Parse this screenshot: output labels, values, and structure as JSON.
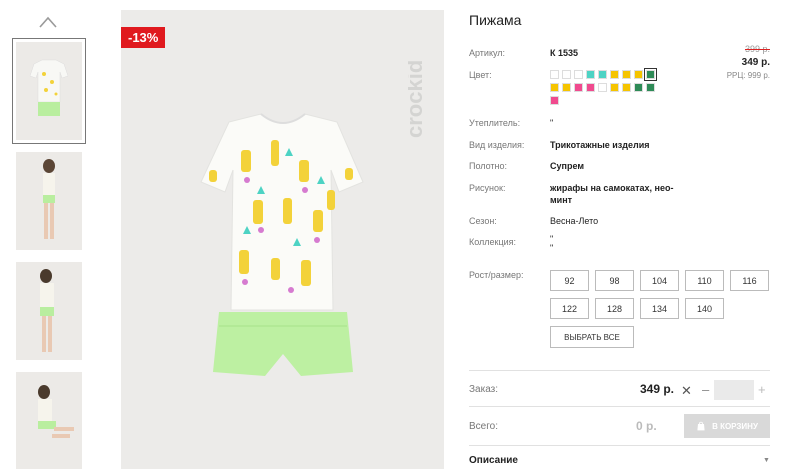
{
  "product": {
    "title": "Пижама",
    "discount_badge": "-13%",
    "brand_logo_text": "crockid",
    "price_old": "399 р.",
    "price_new": "349 р.",
    "rrp": "РРЦ: 999 р."
  },
  "attributes": [
    {
      "label": "Артикул:",
      "value": "К 1535",
      "bold": true
    },
    {
      "label": "Цвет:",
      "value": ""
    },
    {
      "label": "Утеплитель:",
      "value": "\""
    },
    {
      "label": "Вид изделия:",
      "value": "Трикотажные изделия",
      "bold": true
    },
    {
      "label": "Полотно:",
      "value": "Супрем",
      "bold": true
    },
    {
      "label": "Рисунок:",
      "value": "жирафы на самокатах, нео-",
      "value2": "минт",
      "bold": true
    },
    {
      "label": "Сезон:",
      "value": "Весна-Лето"
    },
    {
      "label": "Коллекция:",
      "value": "\"",
      "value2": "\""
    },
    {
      "label": "Рост/размер:",
      "value": ""
    }
  ],
  "swatches": {
    "row1": [
      "#ffffff",
      "#ffffff",
      "#ffffff",
      "#4dd3c4",
      "#4dd3c4",
      "#f5c400",
      "#f5c400",
      "#f5c400",
      "#2e8b57"
    ],
    "row2": [
      "#f5c400",
      "#f5c400",
      "#f04a8e",
      "#f04a8e",
      "#ffffff",
      "#f5c400",
      "#f5c400",
      "#2e8b57",
      "#2e8b57"
    ],
    "row3": [
      "#f04a8e"
    ],
    "selected_index": 8
  },
  "sizes": [
    "92",
    "98",
    "104",
    "110",
    "116",
    "122",
    "128",
    "134",
    "140"
  ],
  "select_all_label": "ВЫБРАТЬ ВСЕ",
  "order": {
    "label": "Заказ:",
    "price": "349 р.",
    "times": "✕",
    "minus": "–",
    "plus": "+",
    "qty": ""
  },
  "total": {
    "label": "Всего:",
    "value": "0 р.",
    "cart_label": "В КОРЗИНУ"
  },
  "description_label": "Описание",
  "colors": {
    "accent_red": "#e0191e",
    "swatch_selected_border": "#333333"
  }
}
